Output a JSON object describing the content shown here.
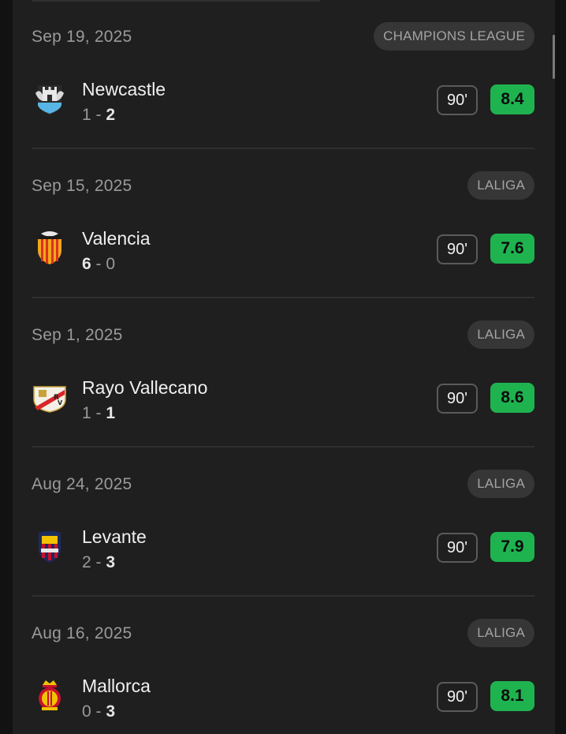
{
  "matches": [
    {
      "date": "Sep 19, 2025",
      "league": "CHAMPIONS LEAGUE",
      "opponent": "Newcastle",
      "score_home": "1",
      "score_sep": "-",
      "score_away": "2",
      "bold_side": "away",
      "minutes": "90'",
      "rating": "8.4",
      "logo_icon": "newcastle-crest-icon"
    },
    {
      "date": "Sep 15, 2025",
      "league": "LALIGA",
      "opponent": "Valencia",
      "score_home": "6",
      "score_sep": "-",
      "score_away": "0",
      "bold_side": "home",
      "minutes": "90'",
      "rating": "7.6",
      "logo_icon": "valencia-crest-icon"
    },
    {
      "date": "Sep 1, 2025",
      "league": "LALIGA",
      "opponent": "Rayo Vallecano",
      "score_home": "1",
      "score_sep": "-",
      "score_away": "1",
      "bold_side": "away",
      "minutes": "90'",
      "rating": "8.6",
      "logo_icon": "rayo-vallecano-crest-icon"
    },
    {
      "date": "Aug 24, 2025",
      "league": "LALIGA",
      "opponent": "Levante",
      "score_home": "2",
      "score_sep": "-",
      "score_away": "3",
      "bold_side": "away",
      "minutes": "90'",
      "rating": "7.9",
      "logo_icon": "levante-crest-icon"
    },
    {
      "date": "Aug 16, 2025",
      "league": "LALIGA",
      "opponent": "Mallorca",
      "score_home": "0",
      "score_sep": "-",
      "score_away": "3",
      "bold_side": "away",
      "minutes": "90'",
      "rating": "8.1",
      "logo_icon": "mallorca-crest-icon"
    }
  ],
  "colors": {
    "background": "#121212",
    "card": "#1f1f1f",
    "rating_green": "#1fb350",
    "badge_bg": "#363636",
    "muted_text": "#9a9a9a",
    "primary_text": "#f0f0f0"
  }
}
